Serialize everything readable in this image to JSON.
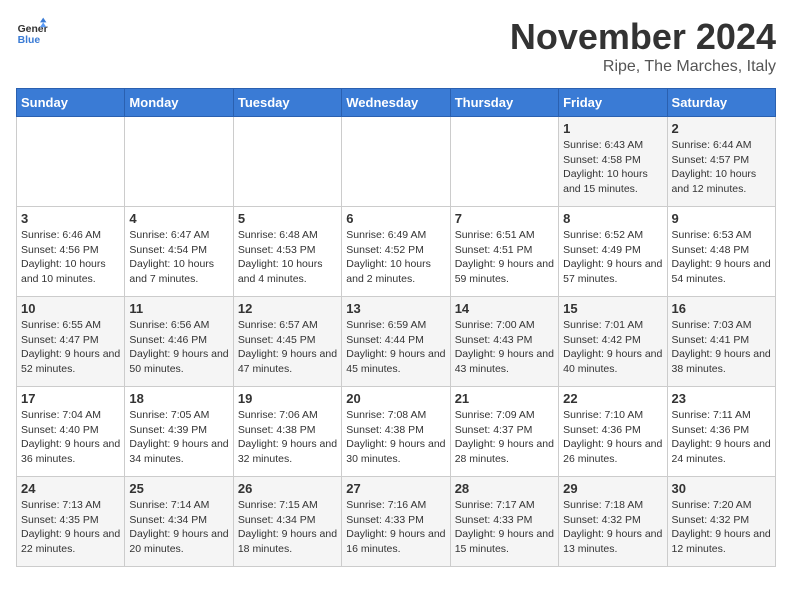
{
  "header": {
    "logo_general": "General",
    "logo_blue": "Blue",
    "title": "November 2024",
    "subtitle": "Ripe, The Marches, Italy"
  },
  "weekdays": [
    "Sunday",
    "Monday",
    "Tuesday",
    "Wednesday",
    "Thursday",
    "Friday",
    "Saturday"
  ],
  "weeks": [
    [
      {
        "day": "",
        "info": ""
      },
      {
        "day": "",
        "info": ""
      },
      {
        "day": "",
        "info": ""
      },
      {
        "day": "",
        "info": ""
      },
      {
        "day": "",
        "info": ""
      },
      {
        "day": "1",
        "info": "Sunrise: 6:43 AM\nSunset: 4:58 PM\nDaylight: 10 hours and 15 minutes."
      },
      {
        "day": "2",
        "info": "Sunrise: 6:44 AM\nSunset: 4:57 PM\nDaylight: 10 hours and 12 minutes."
      }
    ],
    [
      {
        "day": "3",
        "info": "Sunrise: 6:46 AM\nSunset: 4:56 PM\nDaylight: 10 hours and 10 minutes."
      },
      {
        "day": "4",
        "info": "Sunrise: 6:47 AM\nSunset: 4:54 PM\nDaylight: 10 hours and 7 minutes."
      },
      {
        "day": "5",
        "info": "Sunrise: 6:48 AM\nSunset: 4:53 PM\nDaylight: 10 hours and 4 minutes."
      },
      {
        "day": "6",
        "info": "Sunrise: 6:49 AM\nSunset: 4:52 PM\nDaylight: 10 hours and 2 minutes."
      },
      {
        "day": "7",
        "info": "Sunrise: 6:51 AM\nSunset: 4:51 PM\nDaylight: 9 hours and 59 minutes."
      },
      {
        "day": "8",
        "info": "Sunrise: 6:52 AM\nSunset: 4:49 PM\nDaylight: 9 hours and 57 minutes."
      },
      {
        "day": "9",
        "info": "Sunrise: 6:53 AM\nSunset: 4:48 PM\nDaylight: 9 hours and 54 minutes."
      }
    ],
    [
      {
        "day": "10",
        "info": "Sunrise: 6:55 AM\nSunset: 4:47 PM\nDaylight: 9 hours and 52 minutes."
      },
      {
        "day": "11",
        "info": "Sunrise: 6:56 AM\nSunset: 4:46 PM\nDaylight: 9 hours and 50 minutes."
      },
      {
        "day": "12",
        "info": "Sunrise: 6:57 AM\nSunset: 4:45 PM\nDaylight: 9 hours and 47 minutes."
      },
      {
        "day": "13",
        "info": "Sunrise: 6:59 AM\nSunset: 4:44 PM\nDaylight: 9 hours and 45 minutes."
      },
      {
        "day": "14",
        "info": "Sunrise: 7:00 AM\nSunset: 4:43 PM\nDaylight: 9 hours and 43 minutes."
      },
      {
        "day": "15",
        "info": "Sunrise: 7:01 AM\nSunset: 4:42 PM\nDaylight: 9 hours and 40 minutes."
      },
      {
        "day": "16",
        "info": "Sunrise: 7:03 AM\nSunset: 4:41 PM\nDaylight: 9 hours and 38 minutes."
      }
    ],
    [
      {
        "day": "17",
        "info": "Sunrise: 7:04 AM\nSunset: 4:40 PM\nDaylight: 9 hours and 36 minutes."
      },
      {
        "day": "18",
        "info": "Sunrise: 7:05 AM\nSunset: 4:39 PM\nDaylight: 9 hours and 34 minutes."
      },
      {
        "day": "19",
        "info": "Sunrise: 7:06 AM\nSunset: 4:38 PM\nDaylight: 9 hours and 32 minutes."
      },
      {
        "day": "20",
        "info": "Sunrise: 7:08 AM\nSunset: 4:38 PM\nDaylight: 9 hours and 30 minutes."
      },
      {
        "day": "21",
        "info": "Sunrise: 7:09 AM\nSunset: 4:37 PM\nDaylight: 9 hours and 28 minutes."
      },
      {
        "day": "22",
        "info": "Sunrise: 7:10 AM\nSunset: 4:36 PM\nDaylight: 9 hours and 26 minutes."
      },
      {
        "day": "23",
        "info": "Sunrise: 7:11 AM\nSunset: 4:36 PM\nDaylight: 9 hours and 24 minutes."
      }
    ],
    [
      {
        "day": "24",
        "info": "Sunrise: 7:13 AM\nSunset: 4:35 PM\nDaylight: 9 hours and 22 minutes."
      },
      {
        "day": "25",
        "info": "Sunrise: 7:14 AM\nSunset: 4:34 PM\nDaylight: 9 hours and 20 minutes."
      },
      {
        "day": "26",
        "info": "Sunrise: 7:15 AM\nSunset: 4:34 PM\nDaylight: 9 hours and 18 minutes."
      },
      {
        "day": "27",
        "info": "Sunrise: 7:16 AM\nSunset: 4:33 PM\nDaylight: 9 hours and 16 minutes."
      },
      {
        "day": "28",
        "info": "Sunrise: 7:17 AM\nSunset: 4:33 PM\nDaylight: 9 hours and 15 minutes."
      },
      {
        "day": "29",
        "info": "Sunrise: 7:18 AM\nSunset: 4:32 PM\nDaylight: 9 hours and 13 minutes."
      },
      {
        "day": "30",
        "info": "Sunrise: 7:20 AM\nSunset: 4:32 PM\nDaylight: 9 hours and 12 minutes."
      }
    ]
  ]
}
